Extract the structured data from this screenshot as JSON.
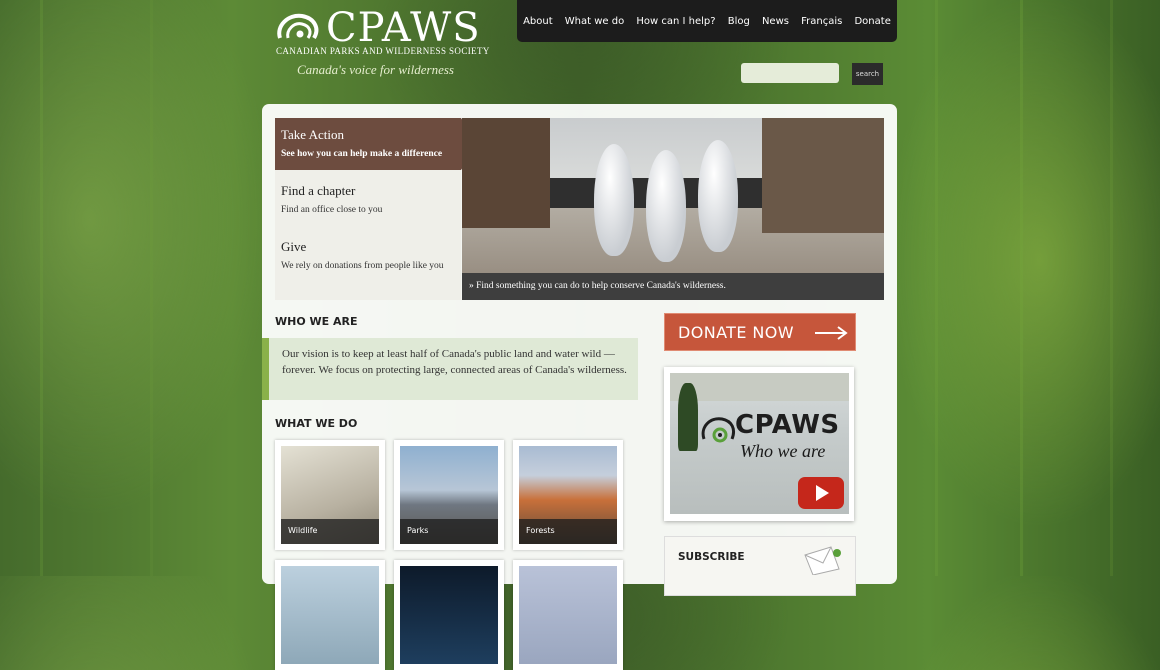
{
  "header": {
    "logo_name": "CPAWS",
    "logo_sub": "CANADIAN PARKS AND WILDERNESS SOCIETY",
    "tagline": "Canada's voice for wilderness"
  },
  "nav": {
    "items": [
      "About",
      "What we do",
      "How can I help?",
      "Blog",
      "News",
      "Français",
      "Donate"
    ]
  },
  "search": {
    "placeholder": "",
    "button_label": "search"
  },
  "action_panel": {
    "items": [
      {
        "title": "Take Action",
        "desc": "See how you can help make a difference"
      },
      {
        "title": "Find a chapter",
        "desc": "Find an office close to you"
      },
      {
        "title": "Give",
        "desc": "We rely on donations from people like you"
      }
    ]
  },
  "hero": {
    "caption": "» Find something you can do to help conserve Canada's wilderness."
  },
  "who_we_are": {
    "heading": "WHO WE ARE",
    "text": "Our vision is to keep at least half of Canada's public land and water wild — forever. We focus on protecting large, connected areas of Canada's wilderness."
  },
  "what_we_do": {
    "heading": "WHAT WE DO",
    "tiles": [
      "Wildlife",
      "Parks",
      "Forests"
    ]
  },
  "sidebar": {
    "donate_label": "DONATE NOW",
    "video_name": "CPAWS",
    "video_sub": "Who we are",
    "subscribe_title": "SUBSCRIBE"
  },
  "colors": {
    "accent_brown": "#6d4c3f",
    "donate_orange": "#c6563b",
    "vision_green": "#8ab14a"
  }
}
